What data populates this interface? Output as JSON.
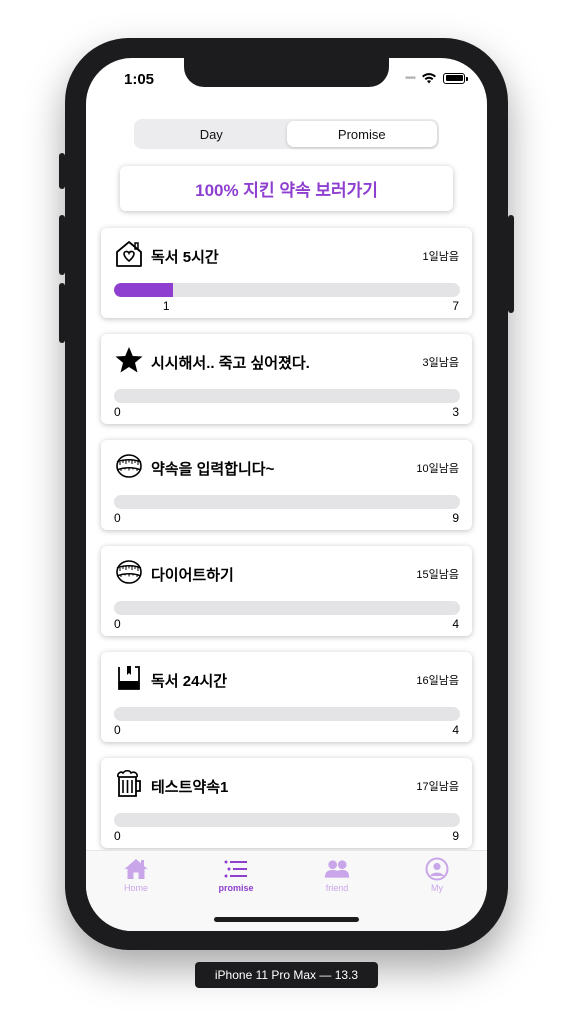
{
  "status": {
    "time": "1:05"
  },
  "segments": [
    {
      "label": "Day"
    },
    {
      "label": "Promise"
    }
  ],
  "banner": {
    "label": "100% 지킨 약속 보러가기"
  },
  "promises": [
    {
      "icon": "house-heart-icon",
      "title": "독서 5시간",
      "days_left": "1일남음",
      "current": "1",
      "goal": "7",
      "progress": 0.17
    },
    {
      "icon": "star-icon",
      "title": "시시해서.. 죽고 싶어졌다.",
      "days_left": "3일남음",
      "current": "0",
      "goal": "3",
      "progress": 0
    },
    {
      "icon": "measuring-tape-icon",
      "title": "약속을 입력합니다~",
      "days_left": "10일남음",
      "current": "0",
      "goal": "9",
      "progress": 0
    },
    {
      "icon": "measuring-tape-icon",
      "title": "다이어트하기",
      "days_left": "15일남음",
      "current": "0",
      "goal": "4",
      "progress": 0
    },
    {
      "icon": "book-icon",
      "title": "독서 24시간",
      "days_left": "16일남음",
      "current": "0",
      "goal": "4",
      "progress": 0
    },
    {
      "icon": "beer-mug-icon",
      "title": "테스트약속1",
      "days_left": "17일남음",
      "current": "0",
      "goal": "9",
      "progress": 0
    }
  ],
  "tabbar": [
    {
      "icon": "home-icon",
      "label": "Home",
      "active": false
    },
    {
      "icon": "list-icon",
      "label": "promise",
      "active": true
    },
    {
      "icon": "people-icon",
      "label": "friend",
      "active": false
    },
    {
      "icon": "user-circle-icon",
      "label": "My",
      "active": false
    }
  ],
  "device": {
    "label": "iPhone 11 Pro Max — 13.3"
  },
  "colors": {
    "accent": "#8e3fd0",
    "accent_light": "#c9a6ea",
    "track": "#e4e4e6"
  }
}
